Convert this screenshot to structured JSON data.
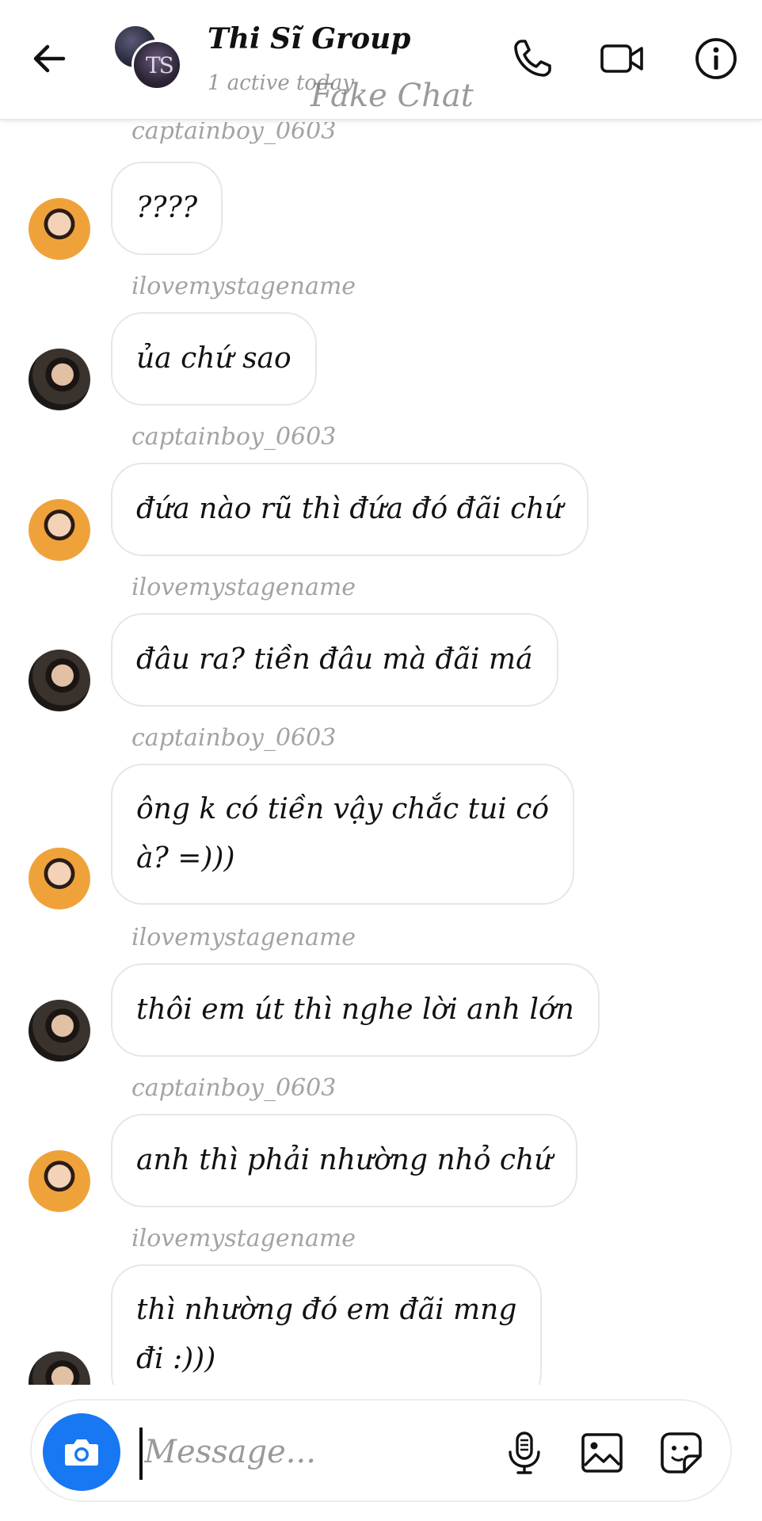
{
  "header": {
    "title": "Thi Sĩ Group",
    "status": "1 active today",
    "watermark": "Fake Chat",
    "avatar_text": "TS"
  },
  "messages": [
    {
      "sender": "captainboy_0603",
      "text": "????",
      "avatar": "orange"
    },
    {
      "sender": "ilovemystagename",
      "text": "ủa chứ sao",
      "avatar": "dark"
    },
    {
      "sender": "captainboy_0603",
      "text": "đứa nào rũ thì đứa đó đãi chứ",
      "avatar": "orange"
    },
    {
      "sender": "ilovemystagename",
      "text": "đâu ra? tiền đâu mà đãi má",
      "avatar": "dark"
    },
    {
      "sender": "captainboy_0603",
      "lines": [
        "ông k có tiền vậy chắc tui có",
        "à? =)))"
      ],
      "avatar": "orange"
    },
    {
      "sender": "ilovemystagename",
      "text": "thôi em út thì nghe lời anh lớn",
      "avatar": "dark"
    },
    {
      "sender": "captainboy_0603",
      "text": "anh thì phải nhường nhỏ chứ",
      "avatar": "orange"
    },
    {
      "sender": "ilovemystagename",
      "lines": [
        "thì nhường đó em đãi mng",
        "đi :)))"
      ],
      "avatar": "dark"
    }
  ],
  "composer": {
    "placeholder": "Message...",
    "value": ""
  },
  "colors": {
    "accent": "#1877f2",
    "bubble_border": "#e6e6e6",
    "sender_text": "#a3a3a3"
  },
  "icons": [
    "back-arrow-icon",
    "phone-icon",
    "video-camera-icon",
    "info-icon",
    "camera-icon",
    "microphone-icon",
    "gallery-icon",
    "sticker-icon"
  ]
}
